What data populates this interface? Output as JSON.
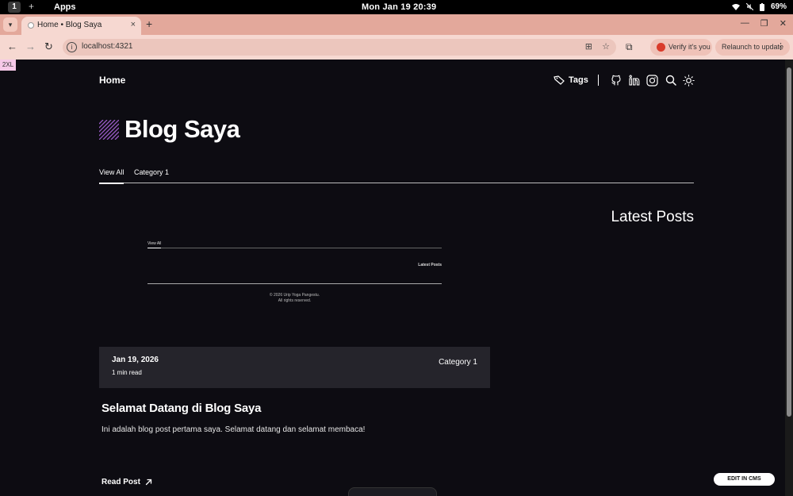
{
  "os": {
    "workspace": "1",
    "apps_label": "Apps",
    "clock": "Mon Jan 19  20:39",
    "battery": "69%"
  },
  "browser": {
    "tab_title": "Home • Blog Saya",
    "url": "localhost:4321",
    "verify_label": "Verify it's you",
    "relaunch_label": "Relaunch to update"
  },
  "page": {
    "breakpoint_badge": "2XL",
    "header": {
      "home_label": "Home",
      "tags_label": "Tags"
    },
    "hero_title": "Blog Saya",
    "categories": {
      "view_all": "View All",
      "category_1": "Category 1"
    },
    "latest_posts_heading": "Latest Posts",
    "thumbnail": {
      "view_all": "View All",
      "latest_posts": "Latest Posts",
      "footer_line1": "© 2026 Urip Yoga Pangestu.",
      "footer_line2": "All rights reserved."
    },
    "post": {
      "date": "Jan 19, 2026",
      "read_time": "1 min read",
      "category": "Category 1",
      "title": "Selamat Datang di Blog Saya",
      "description": "Ini adalah blog post pertama saya. Selamat datang dan selamat membaca!",
      "read_post_label": "Read Post"
    },
    "edit_cms_label": "EDIT IN CMS"
  }
}
